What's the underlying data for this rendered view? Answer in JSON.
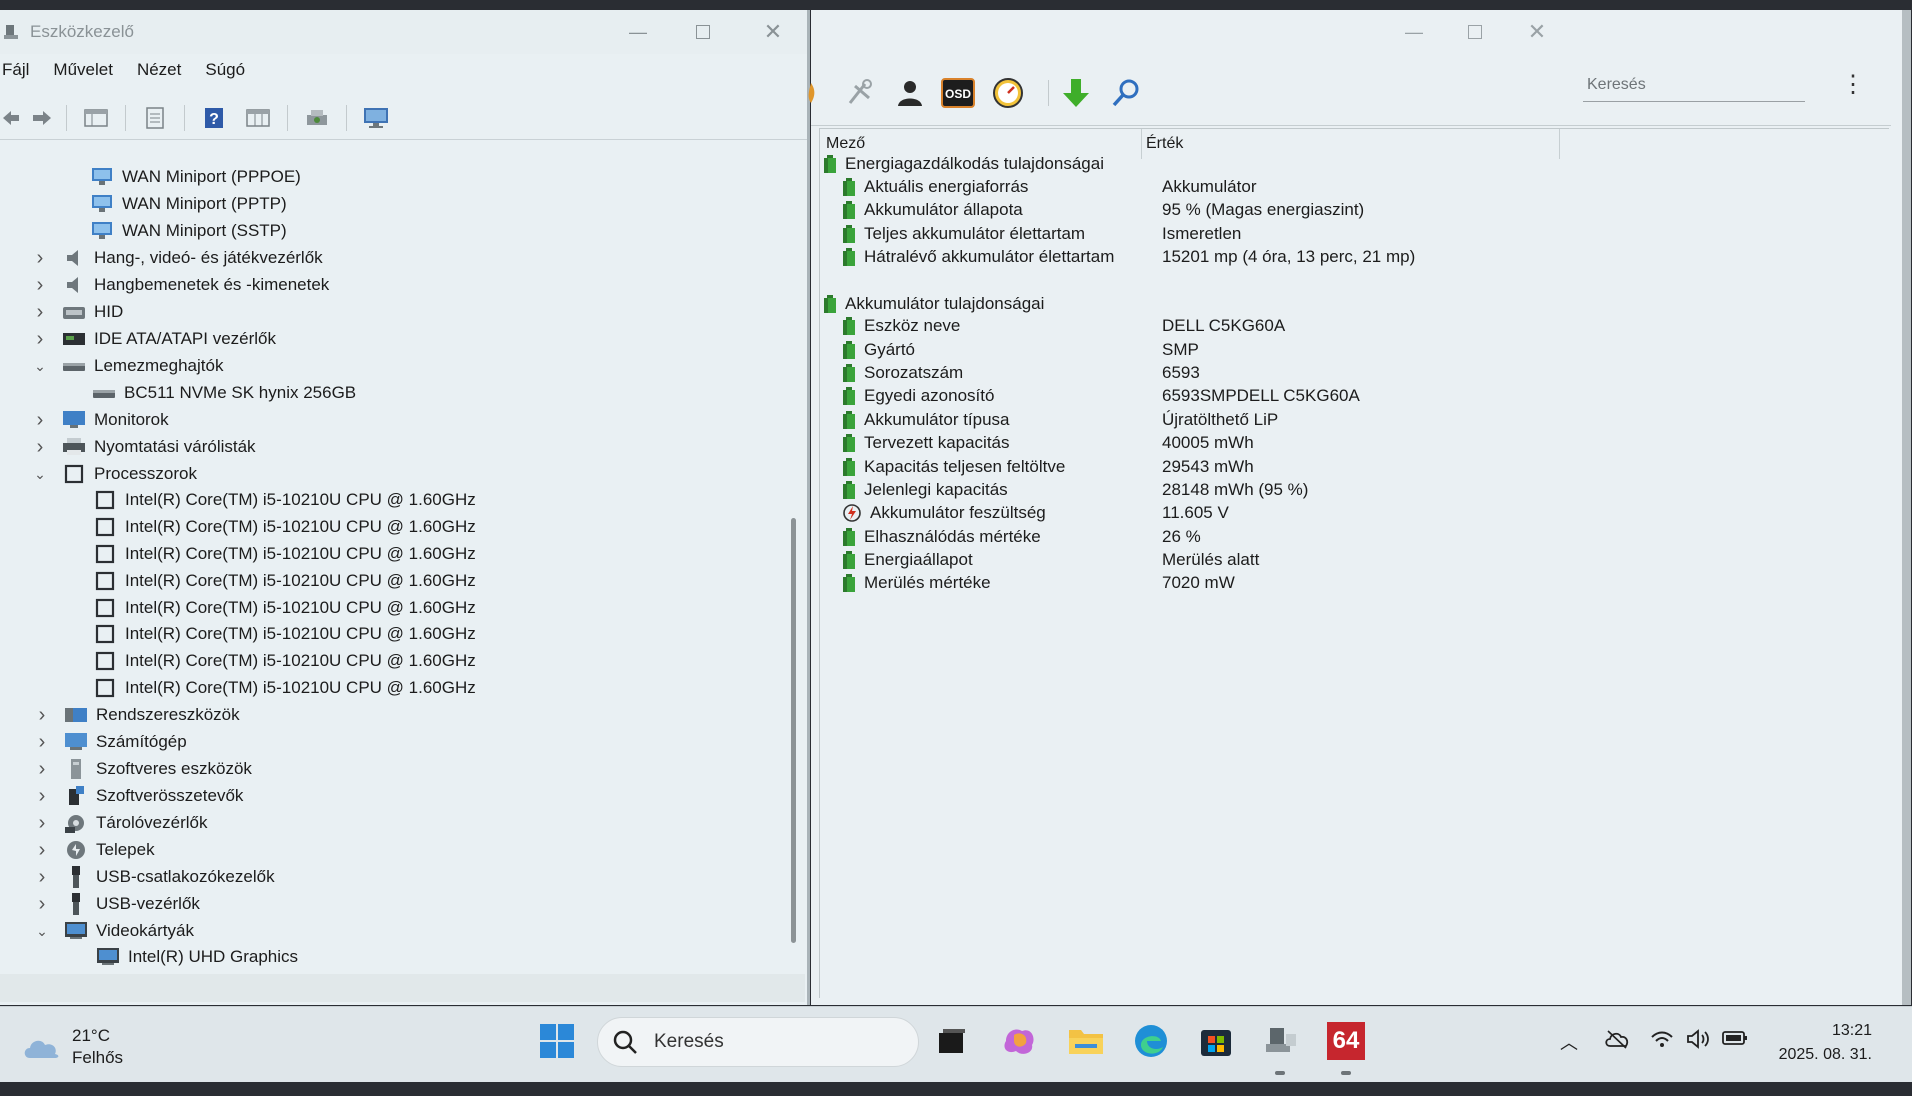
{
  "devmgr": {
    "title": "Eszközkezelő",
    "menu": [
      "Fájl",
      "Művelet",
      "Nézet",
      "Súgó"
    ],
    "tree": [
      {
        "label": "WAN Miniport (PPPOE)",
        "level": 2,
        "icon": "network-adapter-icon"
      },
      {
        "label": "WAN Miniport (PPTP)",
        "level": 2,
        "icon": "network-adapter-icon"
      },
      {
        "label": "WAN Miniport (SSTP)",
        "level": 2,
        "icon": "network-adapter-icon"
      },
      {
        "label": "Hang-, videó- és játékvezérlők",
        "level": 1,
        "expand": "collapsed",
        "icon": "speaker-icon"
      },
      {
        "label": "Hangbemenetek és -kimenetek",
        "level": 1,
        "expand": "collapsed",
        "icon": "speaker-icon"
      },
      {
        "label": "HID",
        "level": 1,
        "expand": "collapsed",
        "icon": "hid-icon"
      },
      {
        "label": "IDE ATA/ATAPI vezérlők",
        "level": 1,
        "expand": "collapsed",
        "icon": "ide-controller-icon"
      },
      {
        "label": "Lemezmeghajtók",
        "level": 1,
        "expand": "expanded",
        "icon": "disk-drive-icon"
      },
      {
        "label": "BC511 NVMe SK hynix 256GB",
        "level": 2,
        "icon": "disk-drive-icon"
      },
      {
        "label": "Monitorok",
        "level": 1,
        "expand": "collapsed",
        "icon": "monitor-icon"
      },
      {
        "label": "Nyomtatási várólisták",
        "level": 1,
        "expand": "collapsed",
        "icon": "printer-icon"
      },
      {
        "label": "Processzorok",
        "level": 1,
        "expand": "expanded",
        "icon": "processor-icon"
      },
      {
        "label": "Intel(R) Core(TM) i5-10210U CPU @ 1.60GHz",
        "level": 2,
        "icon": "processor-icon"
      },
      {
        "label": "Intel(R) Core(TM) i5-10210U CPU @ 1.60GHz",
        "level": 2,
        "icon": "processor-icon"
      },
      {
        "label": "Intel(R) Core(TM) i5-10210U CPU @ 1.60GHz",
        "level": 2,
        "icon": "processor-icon"
      },
      {
        "label": "Intel(R) Core(TM) i5-10210U CPU @ 1.60GHz",
        "level": 2,
        "icon": "processor-icon"
      },
      {
        "label": "Intel(R) Core(TM) i5-10210U CPU @ 1.60GHz",
        "level": 2,
        "icon": "processor-icon"
      },
      {
        "label": "Intel(R) Core(TM) i5-10210U CPU @ 1.60GHz",
        "level": 2,
        "icon": "processor-icon"
      },
      {
        "label": "Intel(R) Core(TM) i5-10210U CPU @ 1.60GHz",
        "level": 2,
        "icon": "processor-icon"
      },
      {
        "label": "Intel(R) Core(TM) i5-10210U CPU @ 1.60GHz",
        "level": 2,
        "icon": "processor-icon"
      },
      {
        "label": "Rendszereszközök",
        "level": 1,
        "expand": "collapsed",
        "icon": "system-device-icon"
      },
      {
        "label": "Számítógép",
        "level": 1,
        "expand": "collapsed",
        "icon": "computer-icon"
      },
      {
        "label": "Szoftveres eszközök",
        "level": 1,
        "expand": "collapsed",
        "icon": "software-device-icon"
      },
      {
        "label": "Szoftverösszetevők",
        "level": 1,
        "expand": "collapsed",
        "icon": "software-component-icon"
      },
      {
        "label": "Tárolóvezérlők",
        "level": 1,
        "expand": "collapsed",
        "icon": "storage-controller-icon"
      },
      {
        "label": "Telepek",
        "level": 1,
        "expand": "collapsed",
        "icon": "battery-icon"
      },
      {
        "label": "USB-csatlakozókezelők",
        "level": 1,
        "expand": "collapsed",
        "icon": "usb-icon"
      },
      {
        "label": "USB-vezérlők",
        "level": 1,
        "expand": "collapsed",
        "icon": "usb-icon"
      },
      {
        "label": "Videokártyák",
        "level": 1,
        "expand": "expanded",
        "icon": "display-adapter-icon"
      },
      {
        "label": "Intel(R) UHD Graphics",
        "level": 2,
        "icon": "display-adapter-icon"
      }
    ]
  },
  "aida": {
    "osd_label": "OSD",
    "search_placeholder": "Keresés",
    "columns": [
      "Mező",
      "Érték"
    ],
    "groups": [
      {
        "title": "Energiagazdálkodás tulajdonságai",
        "rows": [
          {
            "field": "Aktuális energiaforrás",
            "value": "Akkumulátor"
          },
          {
            "field": "Akkumulátor állapota",
            "value": "95 % (Magas energiaszint)"
          },
          {
            "field": "Teljes akkumulátor élettartam",
            "value": "Ismeretlen"
          },
          {
            "field": "Hátralévő akkumulátor élettartam",
            "value": "15201 mp (4 óra, 13 perc, 21 mp)"
          }
        ]
      },
      {
        "title": "Akkumulátor tulajdonságai",
        "rows": [
          {
            "field": "Eszköz neve",
            "value": "DELL C5KG60A"
          },
          {
            "field": "Gyártó",
            "value": "SMP"
          },
          {
            "field": "Sorozatszám",
            "value": "6593"
          },
          {
            "field": "Egyedi azonosító",
            "value": "6593SMPDELL C5KG60A"
          },
          {
            "field": "Akkumulátor típusa",
            "value": "Újratölthető LiP"
          },
          {
            "field": "Tervezett kapacitás",
            "value": "40005 mWh"
          },
          {
            "field": "Kapacitás teljesen feltöltve",
            "value": "29543 mWh"
          },
          {
            "field": "Jelenlegi kapacitás",
            "value": "28148 mWh  (95 %)"
          },
          {
            "field": "Akkumulátor feszültség",
            "value": "11.605 V",
            "icon": "voltage-icon"
          },
          {
            "field": "Elhasználódás mértéke",
            "value": "26 %"
          },
          {
            "field": "Energiaállapot",
            "value": "Merülés alatt"
          },
          {
            "field": "Merülés mértéke",
            "value": "7020 mW"
          }
        ]
      }
    ]
  },
  "taskbar": {
    "weather_temp": "21°C",
    "weather_desc": "Felhős",
    "search_label": "Keresés",
    "aida_badge": "64",
    "time": "13:21",
    "date": "2025. 08. 31."
  }
}
